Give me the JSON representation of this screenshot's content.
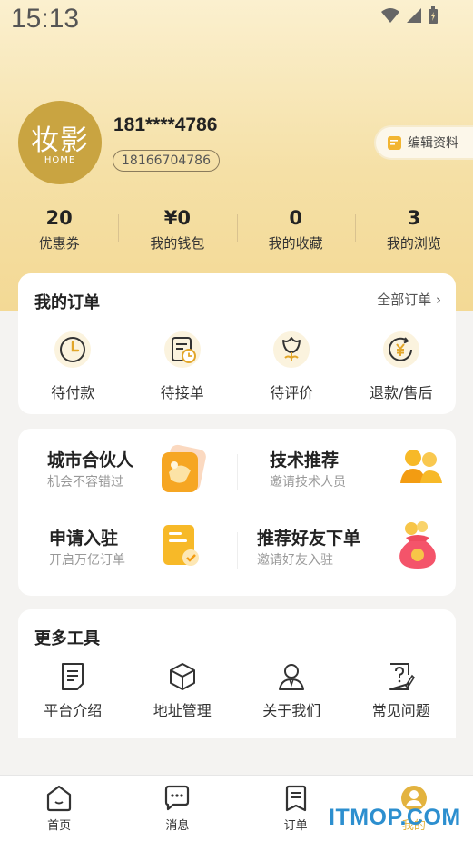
{
  "status": {
    "time": "15:13"
  },
  "profile": {
    "avatar_main": "妆影",
    "avatar_sub": "HOME",
    "phone": "181****4786",
    "id": "18166704786",
    "edit_label": "编辑资料"
  },
  "stats": [
    {
      "value": "20",
      "label": "优惠券"
    },
    {
      "value": "¥0",
      "label": "我的钱包"
    },
    {
      "value": "0",
      "label": "我的收藏"
    },
    {
      "value": "3",
      "label": "我的浏览"
    }
  ],
  "orders": {
    "title": "我的订单",
    "all_label": "全部订单 ›",
    "items": [
      {
        "label": "待付款",
        "icon": "clock-icon"
      },
      {
        "label": "待接单",
        "icon": "document-clock-icon"
      },
      {
        "label": "待评价",
        "icon": "flower-icon"
      },
      {
        "label": "退款/售后",
        "icon": "refund-icon"
      }
    ]
  },
  "promos": [
    {
      "title": "城市合伙人",
      "subtitle": "机会不容错过",
      "icon": "handshake-icon"
    },
    {
      "title": "技术推荐",
      "subtitle": "邀请技术人员",
      "icon": "people-icon"
    },
    {
      "title": "申请入驻",
      "subtitle": "开启万亿订单",
      "icon": "form-icon"
    },
    {
      "title": "推荐好友下单",
      "subtitle": "邀请好友入驻",
      "icon": "money-bag-icon"
    }
  ],
  "tools": {
    "title": "更多工具",
    "items": [
      {
        "label": "平台介绍",
        "icon": "document-icon"
      },
      {
        "label": "地址管理",
        "icon": "box-icon"
      },
      {
        "label": "关于我们",
        "icon": "person-icon"
      },
      {
        "label": "常见问题",
        "icon": "question-icon"
      }
    ]
  },
  "tabs": [
    {
      "label": "首页",
      "icon": "home-icon"
    },
    {
      "label": "消息",
      "icon": "message-icon"
    },
    {
      "label": "订单",
      "icon": "order-icon"
    },
    {
      "label": "我的",
      "icon": "user-icon"
    }
  ],
  "watermark": "ITMOP.COM",
  "colors": {
    "gold": "#c9a441",
    "accent": "#e8b84a",
    "header_bg": "#f5e0a6"
  }
}
